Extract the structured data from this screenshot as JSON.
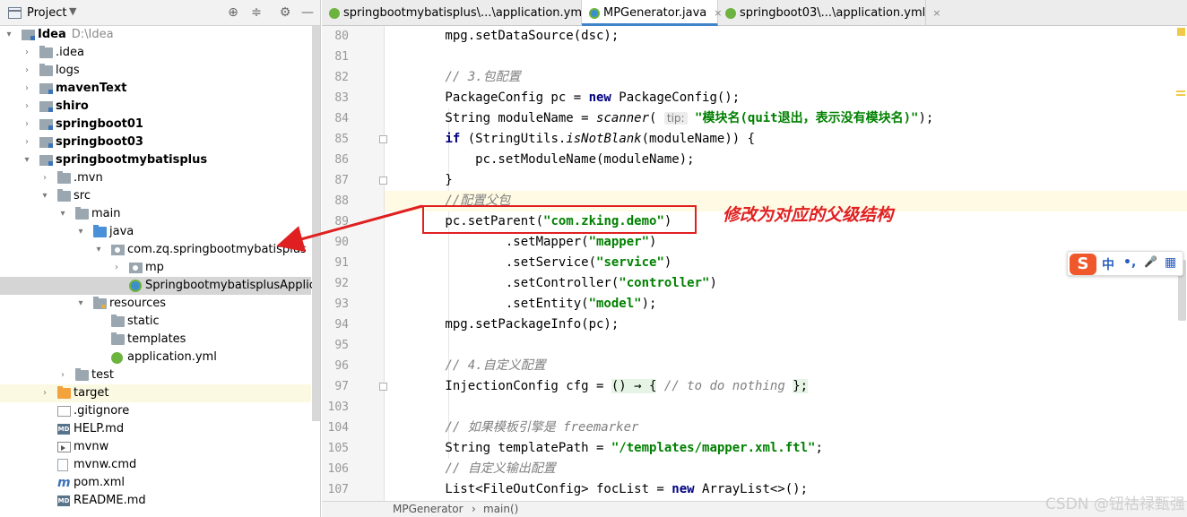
{
  "panel": {
    "title": "Project",
    "dropdown_glyph": "▼",
    "buttons": [
      "locate-icon",
      "collapse-icon",
      "gear-icon",
      "minimize-icon"
    ]
  },
  "tree": [
    {
      "label": "Idea",
      "sub": "D:\\Idea",
      "bold": true,
      "indent": 0,
      "arrow": "▾",
      "icon": "module"
    },
    {
      "label": ".idea",
      "indent": 1,
      "arrow": "›",
      "icon": "folder"
    },
    {
      "label": "logs",
      "indent": 1,
      "arrow": "›",
      "icon": "folder"
    },
    {
      "label": "mavenText",
      "bold": true,
      "indent": 1,
      "arrow": "›",
      "icon": "module"
    },
    {
      "label": "shiro",
      "bold": true,
      "indent": 1,
      "arrow": "›",
      "icon": "module"
    },
    {
      "label": "springboot01",
      "bold": true,
      "indent": 1,
      "arrow": "›",
      "icon": "module"
    },
    {
      "label": "springboot03",
      "bold": true,
      "indent": 1,
      "arrow": "›",
      "icon": "module"
    },
    {
      "label": "springbootmybatisplus",
      "bold": true,
      "indent": 1,
      "arrow": "▾",
      "icon": "module"
    },
    {
      "label": ".mvn",
      "indent": 2,
      "arrow": "›",
      "icon": "folder"
    },
    {
      "label": "src",
      "indent": 2,
      "arrow": "▾",
      "icon": "folder"
    },
    {
      "label": "main",
      "indent": 3,
      "arrow": "▾",
      "icon": "folder"
    },
    {
      "label": "java",
      "indent": 4,
      "arrow": "▾",
      "icon": "blue"
    },
    {
      "label": "com.zq.springbootmybatisplus",
      "indent": 5,
      "arrow": "▾",
      "icon": "pkg"
    },
    {
      "label": "mp",
      "indent": 6,
      "arrow": "›",
      "icon": "pkg"
    },
    {
      "label": "SpringbootmybatisplusApplication",
      "indent": 6,
      "arrow": "",
      "icon": "springclass",
      "selected": true
    },
    {
      "label": "resources",
      "indent": 4,
      "arrow": "▾",
      "icon": "res"
    },
    {
      "label": "static",
      "indent": 5,
      "arrow": "",
      "icon": "folder"
    },
    {
      "label": "templates",
      "indent": 5,
      "arrow": "",
      "icon": "folder"
    },
    {
      "label": "application.yml",
      "indent": 5,
      "arrow": "",
      "icon": "spring"
    },
    {
      "label": "test",
      "indent": 3,
      "arrow": "›",
      "icon": "folder"
    },
    {
      "label": "target",
      "indent": 2,
      "arrow": "›",
      "icon": "orange",
      "excluded": true
    },
    {
      "label": ".gitignore",
      "indent": 2,
      "arrow": "",
      "icon": "git"
    },
    {
      "label": "HELP.md",
      "indent": 2,
      "arrow": "",
      "icon": "md"
    },
    {
      "label": "mvnw",
      "indent": 2,
      "arrow": "",
      "icon": "mvn"
    },
    {
      "label": "mvnw.cmd",
      "indent": 2,
      "arrow": "",
      "icon": "file"
    },
    {
      "label": "pom.xml",
      "indent": 2,
      "arrow": "",
      "icon": "pom"
    },
    {
      "label": "README.md",
      "indent": 2,
      "arrow": "",
      "icon": "md"
    }
  ],
  "tabs": [
    {
      "label": "springbootmybatisplus\\...\\application.yml",
      "icon": "spring",
      "active": false
    },
    {
      "label": "MPGenerator.java",
      "icon": "java",
      "active": true
    },
    {
      "label": "springboot03\\...\\application.yml",
      "icon": "spring",
      "active": false
    }
  ],
  "tab_close_glyph": "×",
  "line_numbers": [
    "80",
    "81",
    "82",
    "83",
    "84",
    "85",
    "86",
    "87",
    "88",
    "89",
    "90",
    "91",
    "92",
    "93",
    "94",
    "95",
    "96",
    "97",
    "103",
    "104",
    "105",
    "106",
    "107"
  ],
  "code_lines": [
    [
      {
        "t": "        mpg.setDataSource(dsc);"
      }
    ],
    [
      {
        "t": ""
      }
    ],
    [
      {
        "t": "        "
      },
      {
        "t": "// 3.包配置",
        "c": "cmt"
      }
    ],
    [
      {
        "t": "        PackageConfig pc = "
      },
      {
        "t": "new",
        "c": "kw"
      },
      {
        "t": " PackageConfig();"
      }
    ],
    [
      {
        "t": "        String moduleName = "
      },
      {
        "t": "scanner",
        "c": "it"
      },
      {
        "t": "( "
      },
      {
        "t": "tip:",
        "c": "hint"
      },
      {
        "t": " "
      },
      {
        "t": "\"模块名(quit退出，表示没有模块名)\"",
        "c": "str"
      },
      {
        "t": ");"
      }
    ],
    [
      {
        "t": "        "
      },
      {
        "t": "if",
        "c": "kw"
      },
      {
        "t": " (StringUtils."
      },
      {
        "t": "isNotBlank",
        "c": "it"
      },
      {
        "t": "(moduleName)) {"
      }
    ],
    [
      {
        "t": "            pc.setModuleName(moduleName);"
      }
    ],
    [
      {
        "t": "        }"
      }
    ],
    [
      {
        "t": "        "
      },
      {
        "t": "//配置父包",
        "c": "cmt"
      }
    ],
    [
      {
        "t": "        pc.setParent("
      },
      {
        "t": "\"com.zking.demo\"",
        "c": "str"
      },
      {
        "t": ")"
      }
    ],
    [
      {
        "t": "                .setMapper("
      },
      {
        "t": "\"mapper\"",
        "c": "str"
      },
      {
        "t": ")"
      }
    ],
    [
      {
        "t": "                .setService("
      },
      {
        "t": "\"service\"",
        "c": "str"
      },
      {
        "t": ")"
      }
    ],
    [
      {
        "t": "                .setController("
      },
      {
        "t": "\"controller\"",
        "c": "str"
      },
      {
        "t": ")"
      }
    ],
    [
      {
        "t": "                .setEntity("
      },
      {
        "t": "\"model\"",
        "c": "str"
      },
      {
        "t": ");"
      }
    ],
    [
      {
        "t": "        mpg.setPackageInfo(pc);"
      }
    ],
    [
      {
        "t": ""
      }
    ],
    [
      {
        "t": "        "
      },
      {
        "t": "// 4.自定义配置",
        "c": "cmt"
      }
    ],
    [
      {
        "t": "        InjectionConfig cfg = "
      },
      {
        "t": "() → {",
        "c": "lam"
      },
      {
        "t": " "
      },
      {
        "t": "// to do nothing",
        "c": "cmt"
      },
      {
        "t": " "
      },
      {
        "t": "};",
        "c": "lam"
      }
    ],
    [
      {
        "t": ""
      }
    ],
    [
      {
        "t": "        "
      },
      {
        "t": "// 如果模板引擎是 freemarker",
        "c": "cmt"
      }
    ],
    [
      {
        "t": "        String templatePath = "
      },
      {
        "t": "\"/templates/mapper.xml.ftl\"",
        "c": "str"
      },
      {
        "t": ";"
      }
    ],
    [
      {
        "t": "        "
      },
      {
        "t": "// 自定义输出配置",
        "c": "cmt"
      }
    ],
    [
      {
        "t": "        List<FileOutConfig> focList = "
      },
      {
        "t": "new",
        "c": "kw"
      },
      {
        "t": " ArrayList<>();"
      }
    ]
  ],
  "highlighted_line": 8,
  "annotation": "修改为对应的父级结构",
  "breadcrumb": [
    "MPGenerator",
    "›",
    "main()"
  ],
  "ime": {
    "logo": "S",
    "items": [
      "中",
      "•,",
      "🎤",
      "▦"
    ]
  },
  "watermark": "CSDN @钮祜禄甄强",
  "colors": {
    "accent": "#4083c9",
    "annotation_red": "#e02020",
    "string_green": "#008000",
    "keyword_navy": "#000080"
  }
}
